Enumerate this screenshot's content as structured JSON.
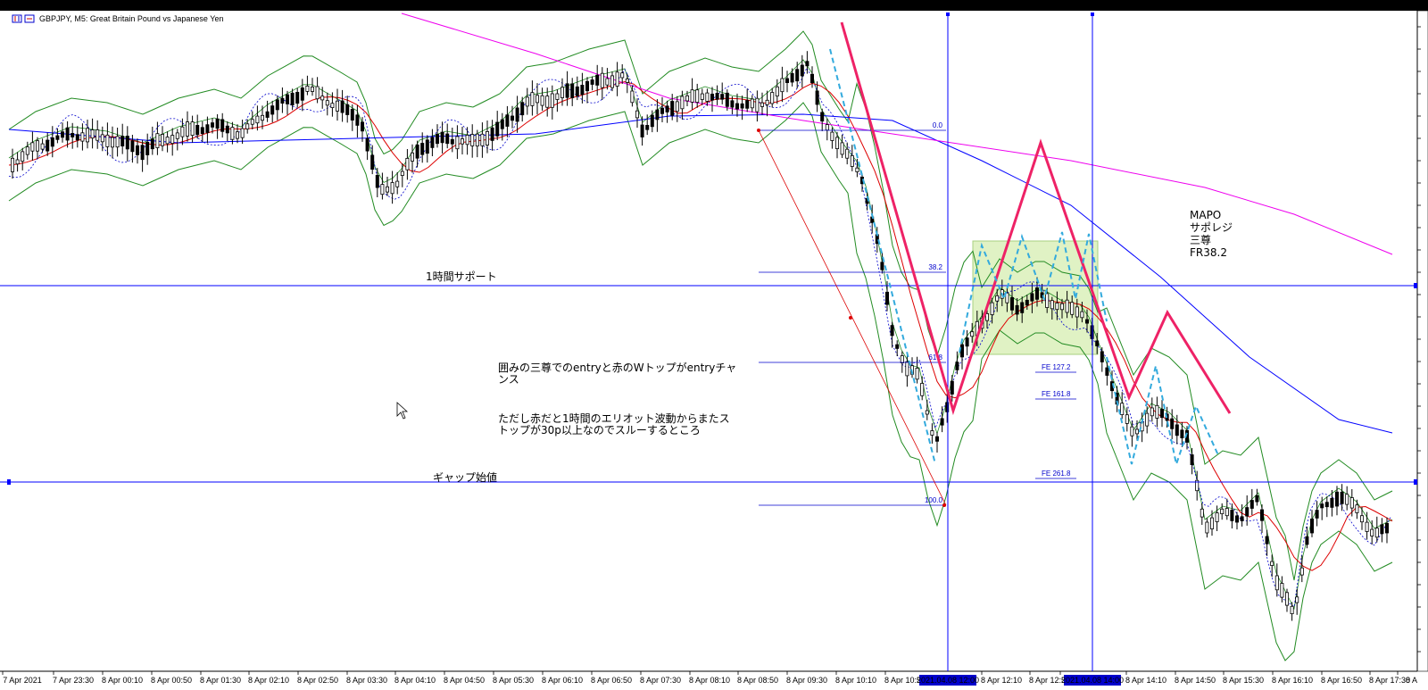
{
  "window": {
    "symbol_title": "GBPJPY, M5:  Great Britain Pound vs Japanese Yen"
  },
  "annotations": {
    "support_label": "1時間サポート",
    "gap_label": "ギャップ始値",
    "mapo_lines": [
      "MAPO",
      "サポレジ",
      "三尊",
      "FR38.2"
    ],
    "note1_lines": [
      "囲みの三尊でのentryと赤のWトップがentryチャ",
      "ンス"
    ],
    "note2_lines": [
      "ただし赤だと1時間のエリオット波動からまたス",
      "トップが30p以上なのでスルーするところ"
    ]
  },
  "fib_labels": [
    "0.0",
    "38.2",
    "61.8",
    "100.0"
  ],
  "fe_labels": [
    "FE  127.2",
    "FE  161.8",
    "FE  261.8"
  ],
  "x_axis_labels": [
    "7 Apr 2021",
    "7 Apr 23:30",
    "8 Apr 00:10",
    "8 Apr 00:50",
    "8 Apr 01:30",
    "8 Apr 02:10",
    "8 Apr 02:50",
    "8 Apr 03:30",
    "8 Apr 04:10",
    "8 Apr 04:50",
    "8 Apr 05:30",
    "8 Apr 06:10",
    "8 Apr 06:50",
    "8 Apr 07:30",
    "8 Apr 08:10",
    "8 Apr 08:50",
    "8 Apr 09:30",
    "8 Apr 10:10",
    "8 Apr 10:50",
    "8 Apr 12:10",
    "8 Apr 12:50",
    "8",
    "8 Apr 14:10",
    "8 Apr 14:50",
    "8 Apr 15:30",
    "8 Apr 16:10",
    "8 Apr 16:50",
    "8 Apr 17:30",
    "8 A"
  ],
  "crosshair_labels": [
    "2021.04.08 12:00",
    "2021.04.08 14:00"
  ],
  "colors": {
    "background": "#ffffff",
    "candle_bull": "#ffffff",
    "candle_bear": "#000000",
    "bollinger": "#228b22",
    "ma_red": "#dd0000",
    "ma_blue": "#0000ff",
    "ma_magenta": "#ee00ee",
    "zigzag_dotted": "#0000cc",
    "pattern_pink": "#ee2266",
    "pattern_cyan": "#33aadd",
    "box_fill": "#d6eeb0",
    "horizontal_line": "#0000ff"
  },
  "chart_data": {
    "type": "candlestick",
    "symbol": "GBPJPY",
    "timeframe": "M5",
    "description_text": "Great Britain Pound vs Japanese Yen",
    "x_start": "7 Apr 2021",
    "x_end": "8 Apr 17:30",
    "grid": false,
    "horizontal_levels": [
      {
        "label": "1時間サポート"
      },
      {
        "label": "ギャップ始値"
      }
    ],
    "vertical_markers": [
      "2021.04.08 12:00",
      "2021.04.08 14:00"
    ],
    "fibonacci_retracement": [
      "0.0",
      "38.2",
      "61.8",
      "100.0"
    ],
    "fibonacci_expansion": [
      "FE 127.2",
      "FE 161.8",
      "FE 261.8"
    ],
    "indicators": [
      "Bollinger Bands",
      "Moving Average (red)",
      "Moving Average (blue)",
      "Moving Average (magenta)",
      "Dotted zigzag"
    ]
  }
}
